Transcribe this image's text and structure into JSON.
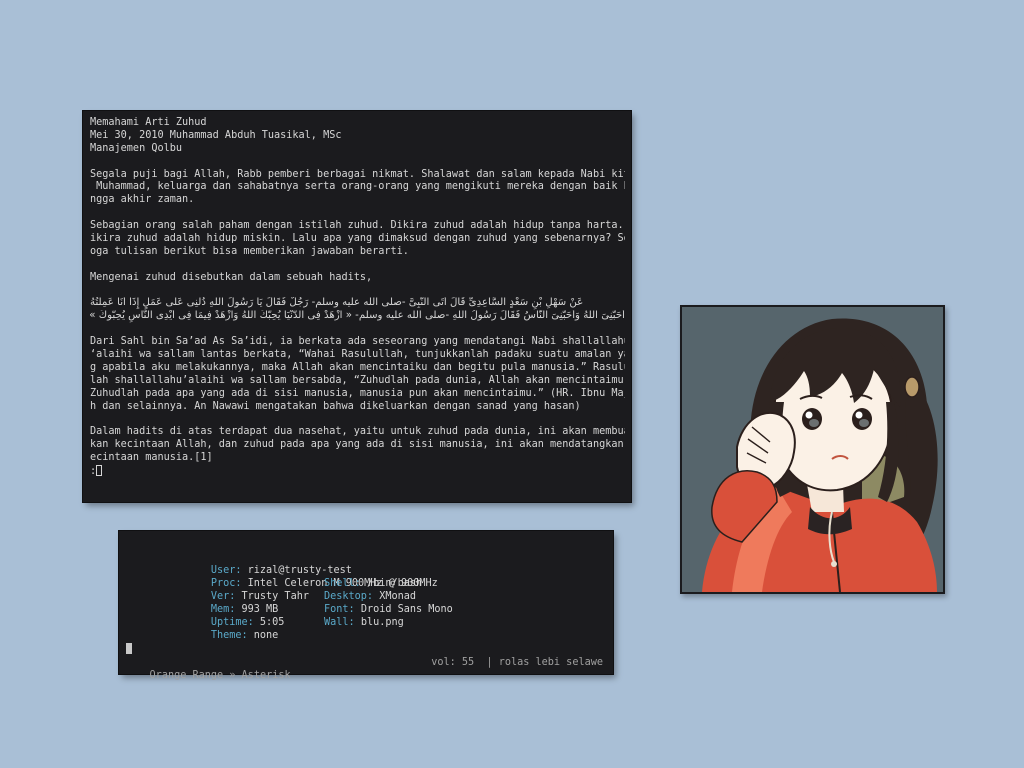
{
  "reader": {
    "lines": [
      "Memahami Arti Zuhud",
      "Mei 30, 2010 Muhammad Abduh Tuasikal, MSc",
      "Manajemen Qolbu",
      "",
      "Segala puji bagi Allah, Rabb pemberi berbagai nikmat. Shalawat dan salam kepada Nabi kita",
      " Muhammad, keluarga dan sahabatnya serta orang-orang yang mengikuti mereka dengan baik hi",
      "ngga akhir zaman.",
      "",
      "Sebagian orang salah paham dengan istilah zuhud. Dikira zuhud adalah hidup tanpa harta. D",
      "ikira zuhud adalah hidup miskin. Lalu apa yang dimaksud dengan zuhud yang sebenarnya? Sem",
      "oga tulisan berikut bisa memberikan jawaban berarti.",
      "",
      "Mengenai zuhud disebutkan dalam sebuah hadits,",
      ""
    ],
    "arabic_lines": [
      "عَنْ سَهْلِ بْنِ سَعْدٍ السَّاعِدِىِّ قَالَ أَتَى النَّبِىَّ -صلى الله عليه وسلم- رَجُلٌ فَقَالَ يَا رَسُولَ اللَّهِ دُلَّنِى عَلَى عَمَلٍ إِذَا أَنَا عَمِلْتُهُ",
      "أَحَبَّنِىَ اللَّهُ وَأَحَبَّنِىَ النَّاسُ فَقَالَ رَسُولُ اللَّهِ -صلى الله عليه وسلم- « ازْهَدْ فِى الدُّنْيَا يُحِبَّكَ اللَّهُ وَازْهَدْ فِيمَا فِى أَيْدِى النَّاسِ يُحِبُّوكَ »."
    ],
    "lines_after": [
      "",
      "Dari Sahl bin Sa’ad As Sa’idi, ia berkata ada seseorang yang mendatangi Nabi shallallahu",
      "‘alaihi wa sallam lantas berkata, “Wahai Rasulullah, tunjukkanlah padaku suatu amalan yan",
      "g apabila aku melakukannya, maka Allah akan mencintaiku dan begitu pula manusia.” Rasulul",
      "lah shallallahu’alaihi wa sallam bersabda, “Zuhudlah pada dunia, Allah akan mencintaimu.",
      "Zuhudlah pada apa yang ada di sisi manusia, manusia pun akan mencintaimu.” (HR. Ibnu Maja",
      "h dan selainnya. An Nawawi mengatakan bahwa dikeluarkan dengan sanad yang hasan)",
      "",
      "Dalam hadits di atas terdapat dua nasehat, yaitu untuk zuhud pada dunia, ini akan membuah",
      "kan kecintaan Allah, dan zuhud pada apa yang ada di sisi manusia, ini akan mendatangkan k",
      "ecintaan manusia.[1]"
    ],
    "prompt": ":"
  },
  "sysinfo": {
    "user_label": "User:",
    "user_value": "rizal@trusty-test",
    "proc_label": "Proc:",
    "proc_value": "Intel Celeron M 900MHz @ 900MHz",
    "ver_label": "Ver:",
    "ver_value": "Trusty Tahr",
    "shell_label": "Shell:",
    "shell_value": "/bin/bash",
    "mem_label": "Mem:",
    "mem_value": "993 MB",
    "desktop_label": "Desktop:",
    "desktop_value": "XMonad",
    "uptime_label": "Uptime:",
    "uptime_value": "5:05",
    "font_label": "Font:",
    "font_value": "Droid Sans Mono",
    "theme_label": "Theme:",
    "theme_value": "none",
    "wall_label": "Wall:",
    "wall_value": "blu.png"
  },
  "player": {
    "track": "Orange Range » Asterisk",
    "volume": "vol: 55",
    "separator": "|",
    "song": "rolas lebi selawe"
  },
  "colors": {
    "desktop_bg": "#a9bfd6",
    "terminal_bg": "#1b1b1e",
    "terminal_fg": "#d6d6d6",
    "label_accent": "#5aa9c9"
  },
  "art": {
    "icon": "anime-girl-portrait-icon"
  }
}
